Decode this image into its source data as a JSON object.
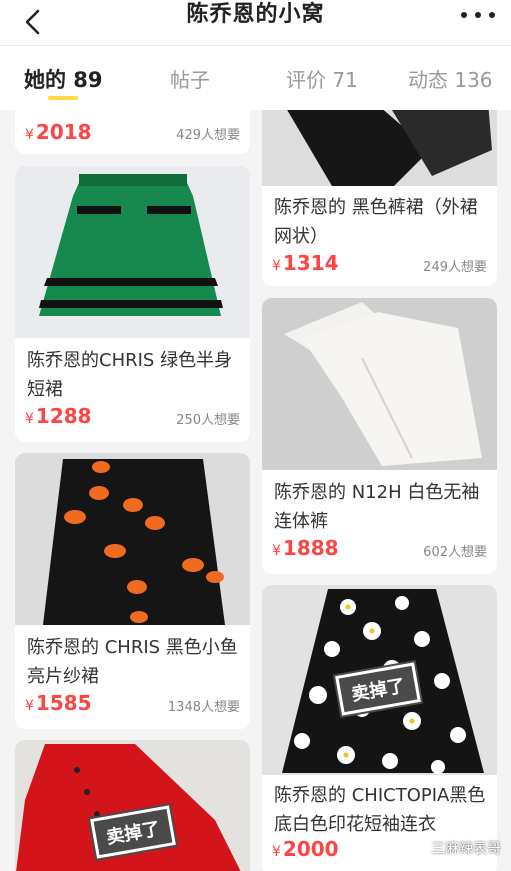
{
  "header": {
    "title": "陈乔恩的小窝"
  },
  "tabs": [
    {
      "label": "她的 89",
      "active": true
    },
    {
      "label": "帖子",
      "active": false
    },
    {
      "label": "评价 71",
      "active": false
    },
    {
      "label": "动态 136",
      "active": false
    }
  ],
  "colors": {
    "accent": "#ffda44",
    "price": "#ff4444"
  },
  "left_column": [
    {
      "name": "",
      "currency": "¥",
      "price": "2018",
      "want": "429人想要",
      "sold": false
    },
    {
      "name": "陈乔恩的CHRIS 绿色半身短裙",
      "currency": "¥",
      "price": "1288",
      "want": "250人想要",
      "sold": false
    },
    {
      "name": "陈乔恩的 CHRIS 黑色小鱼亮片纱裙",
      "currency": "¥",
      "price": "1585",
      "want": "1348人想要",
      "sold": false
    },
    {
      "name": "",
      "currency": "",
      "price": "",
      "want": "",
      "sold": true,
      "sold_label": "卖掉了"
    }
  ],
  "right_column": [
    {
      "name": "陈乔恩的 黑色裤裙（外裙网状）",
      "currency": "¥",
      "price": "1314",
      "want": "249人想要",
      "sold": false
    },
    {
      "name": "陈乔恩的 N12H 白色无袖连体裤",
      "currency": "¥",
      "price": "1888",
      "want": "602人想要",
      "sold": false
    },
    {
      "name": "陈乔恩的 CHICTOPIA黑色底白色印花短袖连衣",
      "currency": "¥",
      "price": "2000",
      "want": "",
      "sold": true,
      "sold_label": "卖掉了"
    }
  ],
  "watermark": "三麻辣表哥"
}
